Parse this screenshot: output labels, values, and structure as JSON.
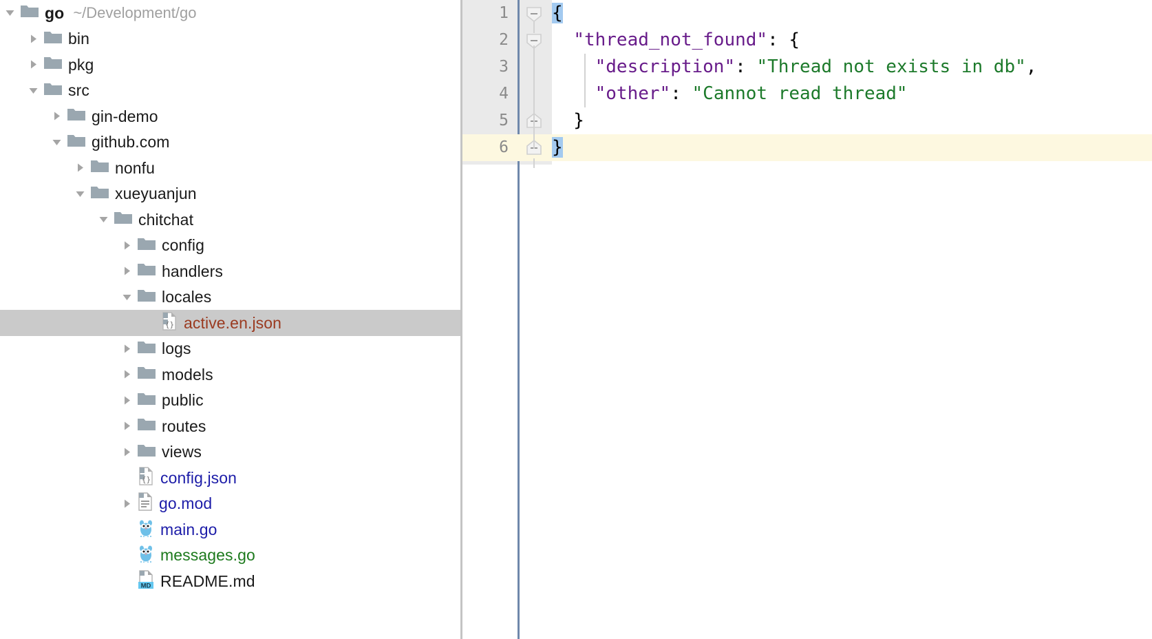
{
  "tree": {
    "rows": [
      {
        "indent": 0,
        "arrow": "down",
        "icon": "folder",
        "label": "go",
        "bold": true,
        "color": "default",
        "sublabel": "~/Development/go",
        "selected": false
      },
      {
        "indent": 1,
        "arrow": "right",
        "icon": "folder",
        "label": "bin",
        "bold": false,
        "color": "default",
        "sublabel": "",
        "selected": false
      },
      {
        "indent": 1,
        "arrow": "right",
        "icon": "folder",
        "label": "pkg",
        "bold": false,
        "color": "default",
        "sublabel": "",
        "selected": false
      },
      {
        "indent": 1,
        "arrow": "down",
        "icon": "folder",
        "label": "src",
        "bold": false,
        "color": "default",
        "sublabel": "",
        "selected": false
      },
      {
        "indent": 2,
        "arrow": "right",
        "icon": "folder",
        "label": "gin-demo",
        "bold": false,
        "color": "default",
        "sublabel": "",
        "selected": false
      },
      {
        "indent": 2,
        "arrow": "down",
        "icon": "folder",
        "label": "github.com",
        "bold": false,
        "color": "default",
        "sublabel": "",
        "selected": false
      },
      {
        "indent": 3,
        "arrow": "right",
        "icon": "folder",
        "label": "nonfu",
        "bold": false,
        "color": "default",
        "sublabel": "",
        "selected": false
      },
      {
        "indent": 3,
        "arrow": "down",
        "icon": "folder",
        "label": "xueyuanjun",
        "bold": false,
        "color": "default",
        "sublabel": "",
        "selected": false
      },
      {
        "indent": 4,
        "arrow": "down",
        "icon": "folder",
        "label": "chitchat",
        "bold": false,
        "color": "default",
        "sublabel": "",
        "selected": false
      },
      {
        "indent": 5,
        "arrow": "right",
        "icon": "folder",
        "label": "config",
        "bold": false,
        "color": "default",
        "sublabel": "",
        "selected": false
      },
      {
        "indent": 5,
        "arrow": "right",
        "icon": "folder",
        "label": "handlers",
        "bold": false,
        "color": "default",
        "sublabel": "",
        "selected": false
      },
      {
        "indent": 5,
        "arrow": "down",
        "icon": "folder",
        "label": "locales",
        "bold": false,
        "color": "default",
        "sublabel": "",
        "selected": false
      },
      {
        "indent": 6,
        "arrow": "none",
        "icon": "json",
        "label": "active.en.json",
        "bold": false,
        "color": "red",
        "sublabel": "",
        "selected": true
      },
      {
        "indent": 5,
        "arrow": "right",
        "icon": "folder",
        "label": "logs",
        "bold": false,
        "color": "default",
        "sublabel": "",
        "selected": false
      },
      {
        "indent": 5,
        "arrow": "right",
        "icon": "folder",
        "label": "models",
        "bold": false,
        "color": "default",
        "sublabel": "",
        "selected": false
      },
      {
        "indent": 5,
        "arrow": "right",
        "icon": "folder",
        "label": "public",
        "bold": false,
        "color": "default",
        "sublabel": "",
        "selected": false
      },
      {
        "indent": 5,
        "arrow": "right",
        "icon": "folder",
        "label": "routes",
        "bold": false,
        "color": "default",
        "sublabel": "",
        "selected": false
      },
      {
        "indent": 5,
        "arrow": "right",
        "icon": "folder",
        "label": "views",
        "bold": false,
        "color": "default",
        "sublabel": "",
        "selected": false
      },
      {
        "indent": 5,
        "arrow": "none",
        "icon": "json",
        "label": "config.json",
        "bold": false,
        "color": "blue",
        "sublabel": "",
        "selected": false
      },
      {
        "indent": 5,
        "arrow": "right",
        "icon": "text",
        "label": "go.mod",
        "bold": false,
        "color": "blue",
        "sublabel": "",
        "selected": false
      },
      {
        "indent": 5,
        "arrow": "none",
        "icon": "go",
        "label": "main.go",
        "bold": false,
        "color": "blue",
        "sublabel": "",
        "selected": false
      },
      {
        "indent": 5,
        "arrow": "none",
        "icon": "go",
        "label": "messages.go",
        "bold": false,
        "color": "green",
        "sublabel": "",
        "selected": false
      },
      {
        "indent": 5,
        "arrow": "none",
        "icon": "md",
        "label": "README.md",
        "bold": false,
        "color": "default",
        "sublabel": "",
        "selected": false
      }
    ]
  },
  "editor": {
    "file": "active.en.json",
    "current_line": 6,
    "lines": [
      {
        "number": "1",
        "fold": "open",
        "current": false,
        "tokens": [
          {
            "t": "{",
            "c": "brace-hl"
          }
        ]
      },
      {
        "number": "2",
        "fold": "open",
        "current": false,
        "tokens": [
          {
            "t": "  ",
            "c": "punct"
          },
          {
            "t": "\"thread_not_found\"",
            "c": "key"
          },
          {
            "t": ": {",
            "c": "punct"
          }
        ]
      },
      {
        "number": "3",
        "fold": "none",
        "current": false,
        "tokens": [
          {
            "t": "    ",
            "c": "punct"
          },
          {
            "t": "\"description\"",
            "c": "key"
          },
          {
            "t": ": ",
            "c": "punct"
          },
          {
            "t": "\"Thread not exists in db\"",
            "c": "str"
          },
          {
            "t": ",",
            "c": "punct"
          }
        ]
      },
      {
        "number": "4",
        "fold": "none",
        "current": false,
        "tokens": [
          {
            "t": "    ",
            "c": "punct"
          },
          {
            "t": "\"other\"",
            "c": "key"
          },
          {
            "t": ": ",
            "c": "punct"
          },
          {
            "t": "\"Cannot read thread\"",
            "c": "str"
          }
        ]
      },
      {
        "number": "5",
        "fold": "close",
        "current": false,
        "tokens": [
          {
            "t": "  }",
            "c": "punct"
          }
        ]
      },
      {
        "number": "6",
        "fold": "close",
        "current": true,
        "tokens": [
          {
            "t": "}",
            "c": "brace-hl"
          }
        ]
      }
    ]
  },
  "colors": {
    "selection_background": "#cacaca",
    "current_line_background": "#fdf8e0",
    "brace_match_background": "#a3caf0",
    "gutter_background": "#eaeaea",
    "gutter_separator": "#6f88ab",
    "json_key": "#681c8a",
    "json_string": "#1d7a2b",
    "file_blue": "#1c1ca8",
    "file_green": "#1d7a1d",
    "file_red": "#9a3a20",
    "folder_icon": "#9aa7b0"
  }
}
